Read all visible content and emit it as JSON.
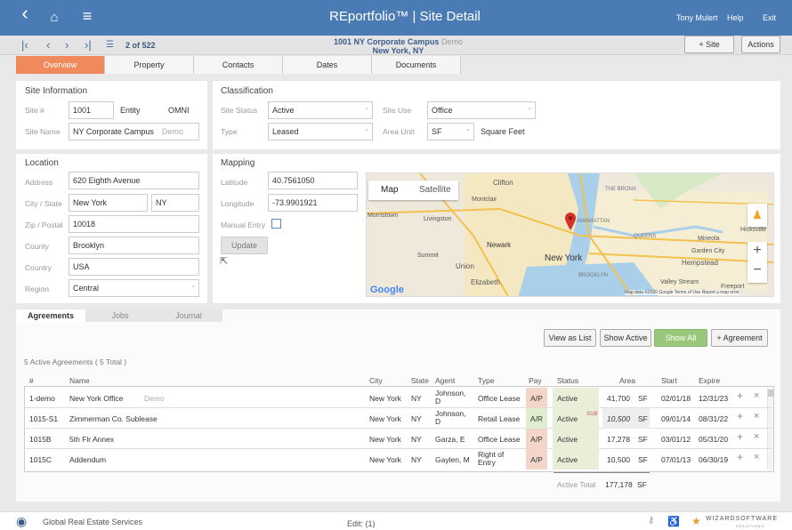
{
  "topbar": {
    "title": "REportfolio™ | Site Detail",
    "user": "Tony Mulert",
    "help": "Help",
    "exit": "Exit",
    "back_icon": "‹",
    "home_icon": "⌂",
    "menu_icon": "≡"
  },
  "record_nav": {
    "count": "2 of 522",
    "site_name": "1001 NY Corporate Campus",
    "site_demo": "Demo",
    "site_city": "New York, NY",
    "add_site": "+ Site",
    "actions": "Actions"
  },
  "tabs": [
    "Overview",
    "Property",
    "Contacts",
    "Dates",
    "Documents"
  ],
  "site_info": {
    "title": "Site Information",
    "site_num_label": "Site #",
    "site_num": "1001",
    "entity_label": "Entity",
    "entity": "OMNI",
    "site_name_label": "Site Name",
    "site_name": "NY Corporate Campus",
    "site_name_demo": "Demo"
  },
  "classification": {
    "title": "Classification",
    "status_label": "Site Status",
    "status": "Active",
    "use_label": "Site Use",
    "use": "Office",
    "type_label": "Type",
    "type": "Leased",
    "area_unit_label": "Area Unit",
    "area_unit": "SF",
    "area_unit_desc": "Square Feet"
  },
  "location": {
    "title": "Location",
    "address_label": "Address",
    "address": "620 Eighth Avenue",
    "city_label": "City / State",
    "city": "New York",
    "state": "NY",
    "zip_label": "Zip / Postal",
    "zip": "10018",
    "county_label": "County",
    "county": "Brooklyn",
    "country_label": "Country",
    "country": "USA",
    "region_label": "Region",
    "region": "Central"
  },
  "mapping": {
    "title": "Mapping",
    "lat_label": "Latitude",
    "lat": "40.7561050",
    "lon_label": "Longitude",
    "lon": "-73.9901921",
    "manual_label": "Manual Entry",
    "update": "Update"
  },
  "map": {
    "map_btn": "Map",
    "satellite_btn": "Satellite",
    "labels": [
      "Clifton",
      "Montclair",
      "Livingston",
      "Newark",
      "Summit",
      "Union",
      "Elizabeth",
      "New York",
      "Mineola",
      "Garden City",
      "Hempstead",
      "Hicksville",
      "Valley Stream",
      "Freeport",
      "Morristown",
      "BROOKLYN",
      "QUEENS",
      "THE BRONX",
      "MANHATTAN"
    ],
    "attribution": "Map data ©2020 Google  Terms of Use  Report a map error",
    "google": "Google"
  },
  "subtabs": [
    "Agreements",
    "Jobs",
    "Journal"
  ],
  "agreements": {
    "view_list": "View as List",
    "show_active": "Show Active",
    "show_all": "Show All",
    "add": "+ Agreement",
    "summary": "5 Active Agreements ( 5 Total )",
    "columns": [
      "#",
      "Name",
      "City",
      "State",
      "Agent",
      "Type",
      "Pay",
      "Status",
      "Area",
      "Start",
      "Expire"
    ],
    "rows": [
      {
        "num": "1-demo",
        "name": "New York Office",
        "demo": "Demo",
        "city": "New York",
        "state": "NY",
        "agent": "Johnson, D",
        "type": "Office Lease",
        "pay": "A/P",
        "status": "Active",
        "sub": "",
        "area": "41,700",
        "unit": "SF",
        "start": "02/01/18",
        "expire": "12/31/23"
      },
      {
        "num": "1015-S1",
        "name": "Zimmerman Co. Sublease",
        "demo": "",
        "city": "New York",
        "state": "NY",
        "agent": "Johnson, D",
        "type": "Retail Lease",
        "pay": "A/R",
        "status": "Active",
        "sub": "SUB",
        "area": "10,500",
        "unit": "SF",
        "start": "09/01/14",
        "expire": "08/31/22"
      },
      {
        "num": "1015B",
        "name": "5th Flr Annex",
        "demo": "",
        "city": "New York",
        "state": "NY",
        "agent": "Garza, E",
        "type": "Office Lease",
        "pay": "A/P",
        "status": "Active",
        "sub": "",
        "area": "17,278",
        "unit": "SF",
        "start": "03/01/12",
        "expire": "05/31/20"
      },
      {
        "num": "1015C",
        "name": "Addendum",
        "demo": "",
        "city": "New York",
        "state": "NY",
        "agent": "Gaylen, M",
        "type": "Right of Entry",
        "pay": "A/P",
        "status": "Active",
        "sub": "",
        "area": "10,500",
        "unit": "SF",
        "start": "07/01/13",
        "expire": "06/30/19"
      }
    ],
    "total_label": "Active Total",
    "total_value": "177,178",
    "total_unit": "SF"
  },
  "footer": {
    "company": "Global Real Estate Services",
    "edit": "Edit: (1)",
    "brand": "WIZARDSOFTWARE",
    "brand_sub": "SOLUTIONS"
  }
}
